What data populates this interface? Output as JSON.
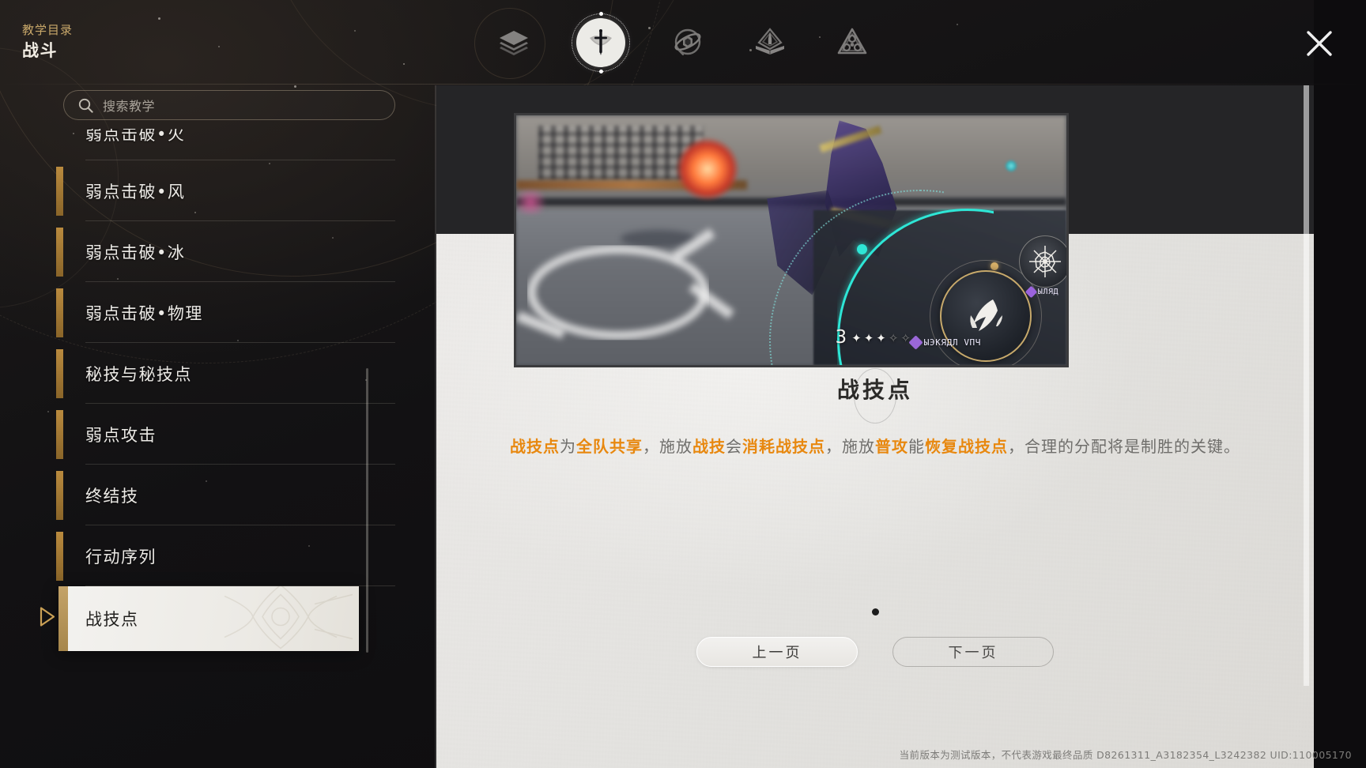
{
  "header": {
    "category_label": "教学目录",
    "category_name": "战斗",
    "close_label": "×"
  },
  "topnav": {
    "items": [
      {
        "id": "layers",
        "icon": "layers-icon",
        "selected": false
      },
      {
        "id": "combat",
        "icon": "sword-icon",
        "selected": true
      },
      {
        "id": "exploration",
        "icon": "globe-icon",
        "selected": false
      },
      {
        "id": "growth",
        "icon": "book-rocket-icon",
        "selected": false
      },
      {
        "id": "system",
        "icon": "triangle-knot-icon",
        "selected": false
      }
    ]
  },
  "search": {
    "placeholder": "搜索教学",
    "icon": "search-icon",
    "value": ""
  },
  "sidebar": {
    "items": [
      {
        "label": "弱点击破•火",
        "selected": false,
        "clipped": true
      },
      {
        "label": "弱点击破•风",
        "selected": false
      },
      {
        "label": "弱点击破•冰",
        "selected": false
      },
      {
        "label": "弱点击破•物理",
        "selected": false
      },
      {
        "label": "秘技与秘技点",
        "selected": false
      },
      {
        "label": "弱点攻击",
        "selected": false
      },
      {
        "label": "终结技",
        "selected": false
      },
      {
        "label": "行动序列",
        "selected": false
      },
      {
        "label": "战技点",
        "selected": true
      }
    ]
  },
  "content": {
    "title": "战技点",
    "media": {
      "name": "tutorial-video",
      "hud": {
        "skill_point_count": "3",
        "pips_filled": 3,
        "pips_empty": 2,
        "nametag_main": "ЫЭКЯДЛ VПЧ",
        "nametag_secondary": "ЫЛЯД"
      }
    },
    "body_segments": [
      {
        "text": "战技点",
        "highlight": true
      },
      {
        "text": "为",
        "highlight": false
      },
      {
        "text": "全队共享",
        "highlight": true
      },
      {
        "text": "，施放",
        "highlight": false
      },
      {
        "text": "战技",
        "highlight": true
      },
      {
        "text": "会",
        "highlight": false
      },
      {
        "text": "消耗战技点",
        "highlight": true
      },
      {
        "text": "，施放",
        "highlight": false
      },
      {
        "text": "普攻",
        "highlight": true
      },
      {
        "text": "能",
        "highlight": false
      },
      {
        "text": "恢复战技点",
        "highlight": true
      },
      {
        "text": "，合理的分配将是制胜的关键。",
        "highlight": false
      }
    ],
    "pagination": {
      "prev_label": "上一页",
      "next_label": "下一页",
      "total_dots": 1,
      "current_dot": 1
    }
  },
  "footer": {
    "text": "当前版本为测试版本，不代表游戏最终品质  D8261311_A3182354_L3242382  UID:110005170"
  },
  "colors": {
    "accent_gold": "#c9a86a",
    "highlight_orange": "#e8880f",
    "panel_light": "#e7e5e2",
    "panel_dark": "#252527",
    "bg_dark": "#121113",
    "hud_teal": "#2ee6d6"
  }
}
